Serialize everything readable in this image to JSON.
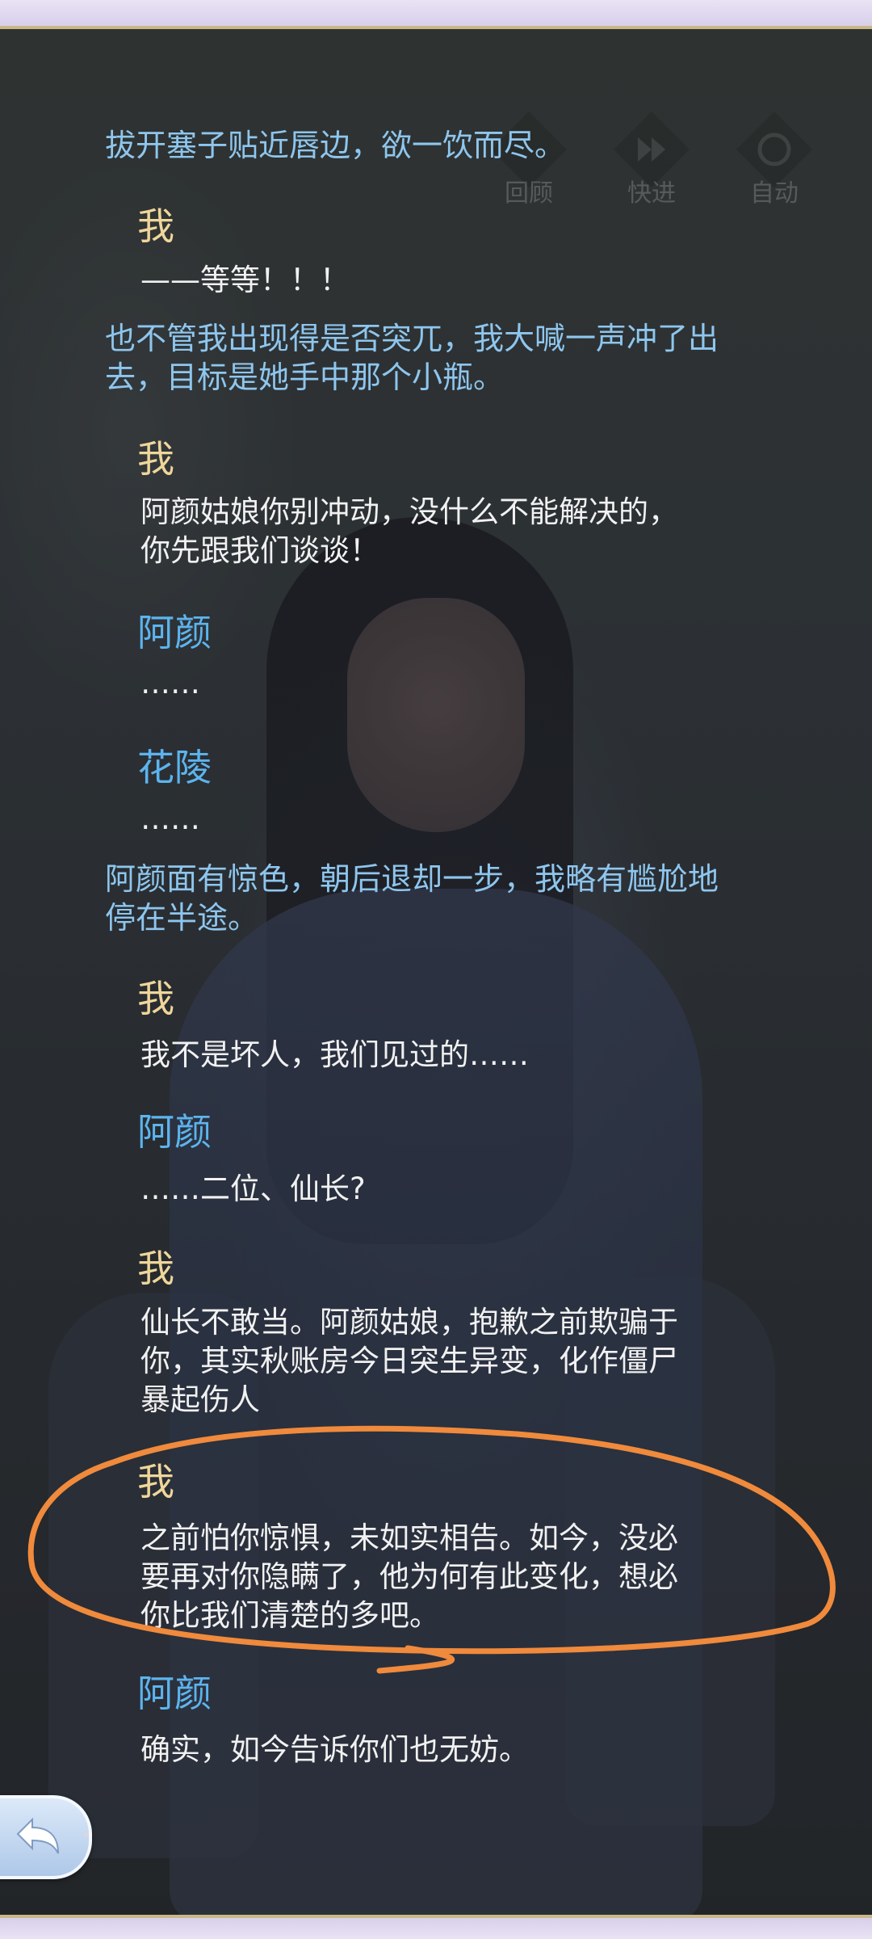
{
  "controls": {
    "review": "回顾",
    "fast_forward": "快进",
    "auto": "自动"
  },
  "log": [
    {
      "kind": "narration",
      "text": "拔开塞子贴近唇边，欲一饮而尽。"
    },
    {
      "kind": "speaker",
      "name": "我"
    },
    {
      "kind": "line",
      "text": "——等等！！！"
    },
    {
      "kind": "narration",
      "line1": "也不管我出现得是否突兀，我大喊一声冲了出",
      "line2": "去，目标是她手中那个小瓶。"
    },
    {
      "kind": "speaker",
      "name": "我"
    },
    {
      "kind": "line",
      "line1": "阿颜姑娘你别冲动，没什么不能解决的，",
      "line2": "你先跟我们谈谈！"
    },
    {
      "kind": "speaker",
      "name": "阿颜"
    },
    {
      "kind": "line",
      "text": "……"
    },
    {
      "kind": "speaker",
      "name": "花陵"
    },
    {
      "kind": "line",
      "text": "……"
    },
    {
      "kind": "narration",
      "line1": "阿颜面有惊色，朝后退却一步，我略有尴尬地",
      "line2": "停在半途。"
    },
    {
      "kind": "speaker",
      "name": "我"
    },
    {
      "kind": "line",
      "text": "我不是坏人，我们见过的……"
    },
    {
      "kind": "speaker",
      "name": "阿颜"
    },
    {
      "kind": "line",
      "text": "……二位、仙长?"
    },
    {
      "kind": "speaker",
      "name": "我"
    },
    {
      "kind": "line",
      "line1": "仙长不敢当。阿颜姑娘，抱歉之前欺骗于",
      "line2": "你，其实秋账房今日突生异变，化作僵尸",
      "line3": "暴起伤人"
    },
    {
      "kind": "speaker",
      "name": "我"
    },
    {
      "kind": "line",
      "line1": "之前怕你惊惧，未如实相告。如今，没必",
      "line2": "要再对你隐瞒了，他为何有此变化，想必",
      "line3": "你比我们清楚的多吧。"
    },
    {
      "kind": "speaker",
      "name": "阿颜"
    },
    {
      "kind": "line",
      "text": "确实，如今告诉你们也无妨。"
    }
  ],
  "ghost_text": "确实，如今告诉你们也无妨。",
  "annotation_color": "#f08a3c",
  "colors": {
    "narration": "#8ec6ee",
    "speaker_me": "#efd69a",
    "speaker_other": "#5cb4ee",
    "dialogue": "#f1f1f1"
  }
}
